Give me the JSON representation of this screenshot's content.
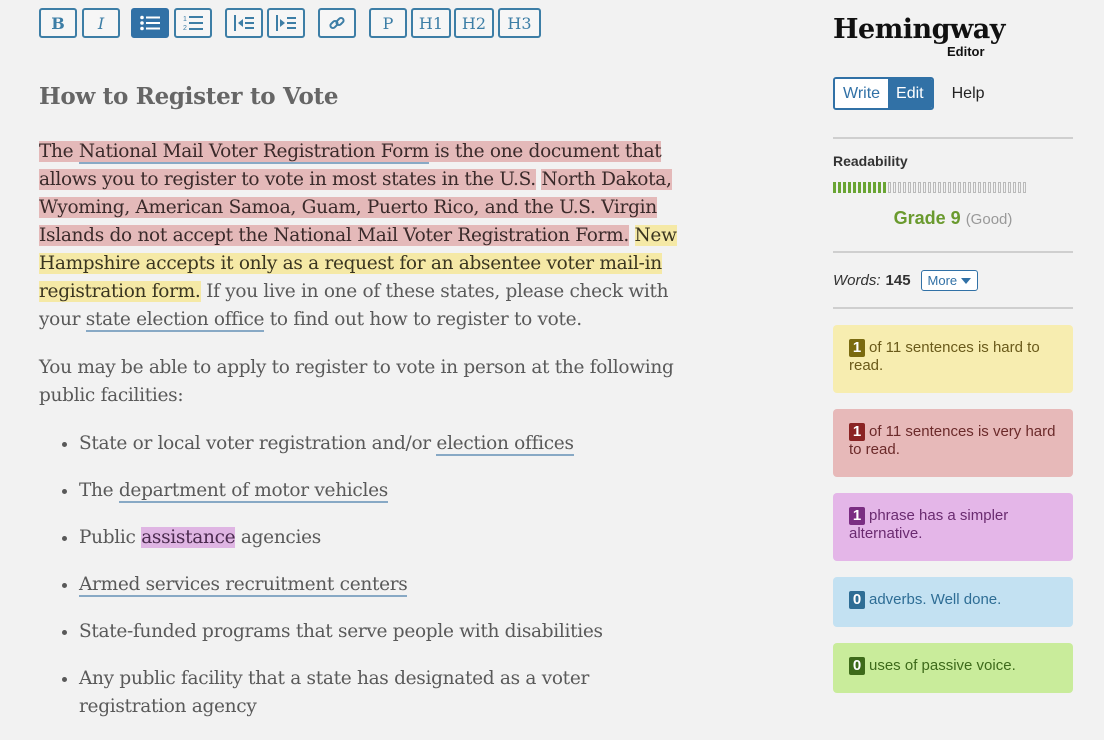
{
  "toolbar": {
    "bold": "B",
    "italic": "I",
    "paragraph": "P",
    "h1": "H1",
    "h2": "H2",
    "h3": "H3"
  },
  "editor": {
    "title": "How to Register to Vote",
    "p1": {
      "red1_a": "The ",
      "red1_link": "National Mail Voter Registration Form",
      "red1_b": " is the one document that allows you to register to vote in most states in the U.S.",
      "red2": "North Dakota, Wyoming, American Samoa, Guam, Puerto Rico, and the U.S. Virgin Islands do not accept the National Mail Voter Registration Form.",
      "yellow": "New Hampshire accepts it only as a request for an absentee voter mail-in registration form.",
      "plain_a": " If you live in one of these states, please check with your ",
      "link": "state election office",
      "plain_b": " to find out how to register to vote."
    },
    "p2": "You may be able to apply to register to vote in person at the following public facilities:",
    "list": [
      {
        "pre": "State or local voter registration and/or ",
        "link": "election offices",
        "post": ""
      },
      {
        "pre": "The ",
        "link": "department of motor vehicles",
        "post": ""
      },
      {
        "pre": "Public ",
        "highlight": "assistance",
        "post": " agencies"
      },
      {
        "link": "Armed services recruitment centers"
      },
      {
        "text": "State-funded programs that serve people with disabilities"
      },
      {
        "text": "Any public facility that a state has designated as a voter registration agency"
      }
    ]
  },
  "sidebar": {
    "logo_main": "Hemingway",
    "logo_sub": "Editor",
    "mode_write": "Write",
    "mode_edit": "Edit",
    "help": "Help",
    "readability_label": "Readability",
    "readability_level": 0.27,
    "grade": "Grade 9",
    "grade_note": "(Good)",
    "words_label": "Words:",
    "words_count": "145",
    "more": "More",
    "cards": {
      "hard": {
        "count": "1",
        "text": "of 11 sentences is hard to read."
      },
      "very_hard": {
        "count": "1",
        "text": "of 11 sentences is very hard to read."
      },
      "simpler": {
        "count": "1",
        "text": "phrase has a simpler alternative."
      },
      "adverbs": {
        "count": "0",
        "text": "adverbs. Well done."
      },
      "passive": {
        "count": "0",
        "text": "uses of passive voice."
      }
    }
  },
  "colors": {
    "accent": "#3171a6",
    "hard": "#f7edb0",
    "very_hard": "#e7b9b9",
    "simpler": "#e4b6e8",
    "adverbs": "#c3e1f2",
    "passive": "#c9ec9b"
  }
}
